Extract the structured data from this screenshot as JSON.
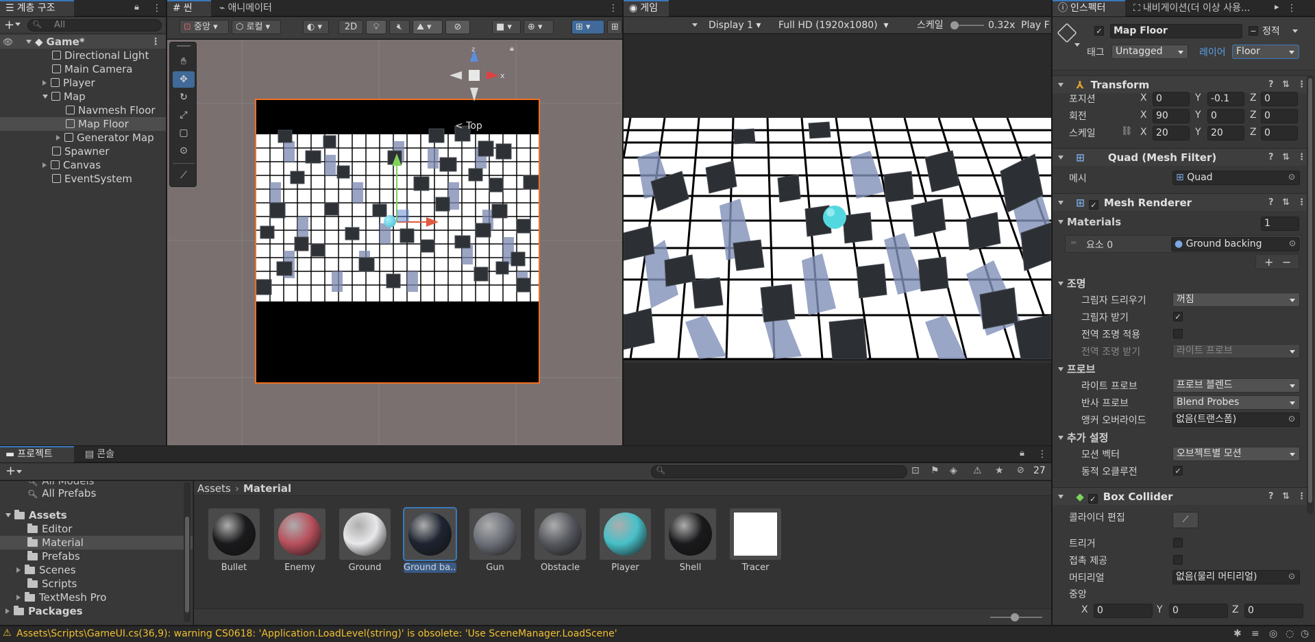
{
  "hierarchy": {
    "tab": "계층 구조",
    "search_placeholder": "All",
    "items": [
      {
        "label": "Game*"
      },
      {
        "label": "Directional Light"
      },
      {
        "label": "Main Camera"
      },
      {
        "label": "Player"
      },
      {
        "label": "Map"
      },
      {
        "label": "Navmesh Floor"
      },
      {
        "label": "Map Floor"
      },
      {
        "label": "Generator Map"
      },
      {
        "label": "Spawner"
      },
      {
        "label": "Canvas"
      },
      {
        "label": "EventSystem"
      }
    ]
  },
  "scene": {
    "tabs": [
      "씬",
      "애니메이터"
    ],
    "toolbar": {
      "pivot": "중앙",
      "space": "로컬",
      "mode2d": "2D"
    },
    "gizmo_label": "< Top"
  },
  "game": {
    "tab": "게임",
    "display": "Display 1",
    "resolution": "Full HD (1920x1080)",
    "scale_label": "스케일",
    "scale_value": "0.32x",
    "play": "Play F"
  },
  "inspector": {
    "tabs": [
      "인스펙터",
      "내비게이션(더 이상 사용..."
    ],
    "object_name": "Map Floor",
    "static_label": "정적",
    "tag_label": "태그",
    "tag_value": "Untagged",
    "layer_label": "레이어",
    "layer_value": "Floor",
    "transform": {
      "title": "Transform",
      "position_label": "포지션",
      "position": {
        "x": "0",
        "y": "-0.1",
        "z": "0"
      },
      "rotation_label": "회전",
      "rotation": {
        "x": "90",
        "y": "0",
        "z": "0"
      },
      "scale_label": "스케일",
      "scale": {
        "x": "20",
        "y": "20",
        "z": "0"
      }
    },
    "mesh_filter": {
      "title": "Quad (Mesh Filter)",
      "mesh_label": "메시",
      "mesh_value": "Quad"
    },
    "mesh_renderer": {
      "title": "Mesh Renderer",
      "materials_label": "Materials",
      "materials_count": "1",
      "element_label": "요소 0",
      "element_value": "Ground backing",
      "lighting_label": "조명",
      "cast_shadows_label": "그림자 드리우기",
      "cast_shadows_value": "꺼짐",
      "receive_shadows_label": "그림자 받기",
      "gi_contrib_label": "전역 조명 적용",
      "gi_receive_label": "전역 조명 받기",
      "gi_receive_value": "라이트 프로브",
      "probes_label": "프로브",
      "light_probes_label": "라이트 프로브",
      "light_probes_value": "프로브 블렌드",
      "reflection_probes_label": "반사 프로브",
      "reflection_probes_value": "Blend Probes",
      "anchor_label": "앵커 오버라이드",
      "anchor_value": "없음(트랜스폼)",
      "additional_label": "추가 설정",
      "motion_label": "모션 벡터",
      "motion_value": "오브젝트별 모션",
      "occlusion_label": "동적 오클루전"
    },
    "box_collider": {
      "title": "Box Collider",
      "edit_label": "콜라이더 편집",
      "trigger_label": "트리거",
      "contact_label": "접촉 제공",
      "material_label": "머티리얼",
      "material_value": "없음(물리 머티리얼)",
      "center_label": "중앙",
      "center": {
        "x": "0",
        "y": "0",
        "z": "0"
      }
    }
  },
  "project": {
    "tabs": [
      "프로젝트",
      "콘솔"
    ],
    "hidden_count": "27",
    "tree": [
      {
        "label": "All Models"
      },
      {
        "label": "All Prefabs"
      },
      {
        "label": "Assets"
      },
      {
        "label": "Editor"
      },
      {
        "label": "Material"
      },
      {
        "label": "Prefabs"
      },
      {
        "label": "Scenes"
      },
      {
        "label": "Scripts"
      },
      {
        "label": "TextMesh Pro"
      },
      {
        "label": "Packages"
      }
    ],
    "breadcrumb": [
      "Assets",
      "Material"
    ],
    "assets": [
      {
        "label": "Bullet",
        "color": "#1a1a1c"
      },
      {
        "label": "Enemy",
        "color": "#b8505c"
      },
      {
        "label": "Ground",
        "color": "#e8e8ea"
      },
      {
        "label": "Ground ba...",
        "color": "#1e2430"
      },
      {
        "label": "Gun",
        "color": "#6c7078"
      },
      {
        "label": "Obstacle",
        "color": "#55585e"
      },
      {
        "label": "Player",
        "color": "#48c0c8"
      },
      {
        "label": "Shell",
        "color": "#1a1a1c"
      },
      {
        "label": "Tracer",
        "color": "#ffffff"
      }
    ]
  },
  "status": {
    "warning": "Assets\\Scripts\\GameUI.cs(36,9): warning CS0618: 'Application.LoadLevel(string)' is obsolete: 'Use SceneManager.LoadScene'"
  }
}
